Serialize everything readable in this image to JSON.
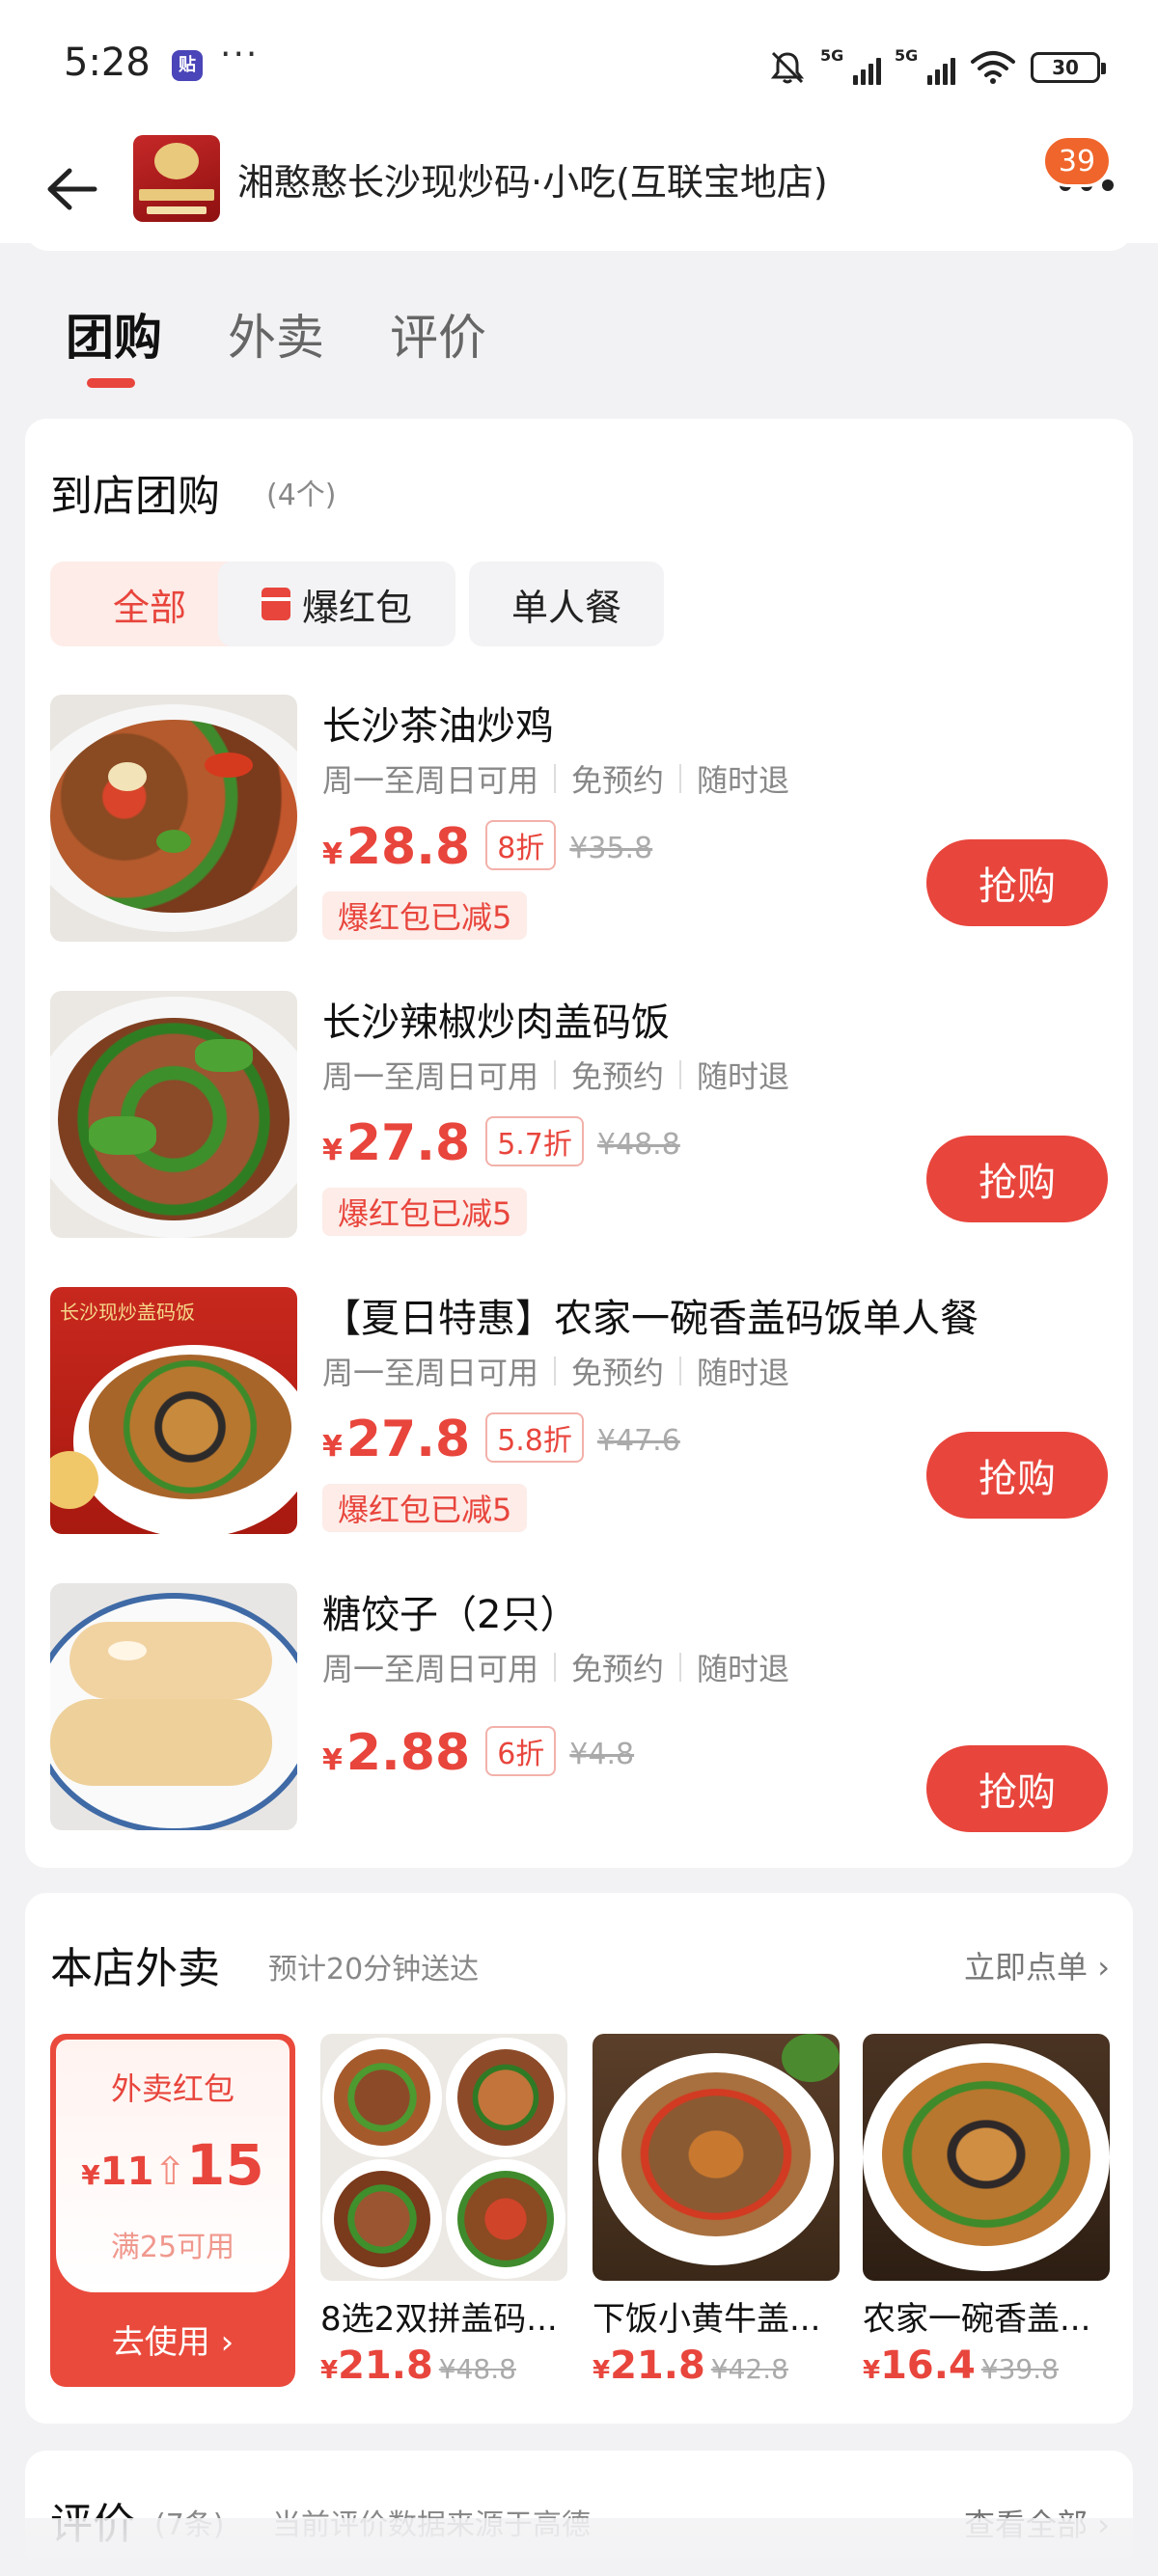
{
  "status_bar": {
    "time": "5:28",
    "app_badge": "贴",
    "more": "···",
    "network1": "5G",
    "network2": "5G",
    "battery": "30"
  },
  "header": {
    "store_name": "湘憨憨长沙现炒码·小吃(互联宝地店)",
    "badge_count": "39"
  },
  "tabs": [
    "团购",
    "外卖",
    "评价"
  ],
  "groupbuy": {
    "title": "到店团购",
    "count": "(4个)",
    "filters": [
      "全部",
      "爆红包",
      "单人餐"
    ],
    "deals": [
      {
        "name": "长沙茶油炒鸡",
        "terms": [
          "周一至周日可用",
          "免预约",
          "随时退"
        ],
        "price": "28.8",
        "discount": "8折",
        "original": "¥35.8",
        "tag": "爆红包已减5",
        "button": "抢购"
      },
      {
        "name": "长沙辣椒炒肉盖码饭",
        "terms": [
          "周一至周日可用",
          "免预约",
          "随时退"
        ],
        "price": "27.8",
        "discount": "5.7折",
        "original": "¥48.8",
        "tag": "爆红包已减5",
        "button": "抢购"
      },
      {
        "name": "【夏日特惠】农家一碗香盖码饭单人餐",
        "terms": [
          "周一至周日可用",
          "免预约",
          "随时退"
        ],
        "price": "27.8",
        "discount": "5.8折",
        "original": "¥47.6",
        "tag": "爆红包已减5",
        "button": "抢购",
        "image_caption": "长沙现炒盖码饭"
      },
      {
        "name": "糖饺子（2只）",
        "terms": [
          "周一至周日可用",
          "免预约",
          "随时退"
        ],
        "price": "2.88",
        "discount": "6折",
        "original": "¥4.8",
        "tag": "",
        "button": "抢购"
      }
    ],
    "currency": "¥"
  },
  "delivery": {
    "title": "本店外卖",
    "eta": "预计20分钟送达",
    "link": "立即点单 ›",
    "coupon": {
      "title": "外卖红包",
      "from": "11",
      "to": "15",
      "condition": "满25可用",
      "button": "去使用 ›"
    },
    "dishes": [
      {
        "name": "8选2双拼盖码...",
        "price": "21.8",
        "original": "¥48.8"
      },
      {
        "name": "下饭小黄牛盖...",
        "price": "21.8",
        "original": "¥42.8"
      },
      {
        "name": "农家一碗香盖...",
        "price": "16.4",
        "original": "¥39.8"
      }
    ]
  },
  "reviews": {
    "title": "评价",
    "count": "(7条)",
    "source": "当前评价数据来源于高德",
    "link": "查看全部 ›"
  },
  "colors": {
    "accent": "#e8453c",
    "background": "#f2f2f4",
    "badge": "#f0652b"
  }
}
